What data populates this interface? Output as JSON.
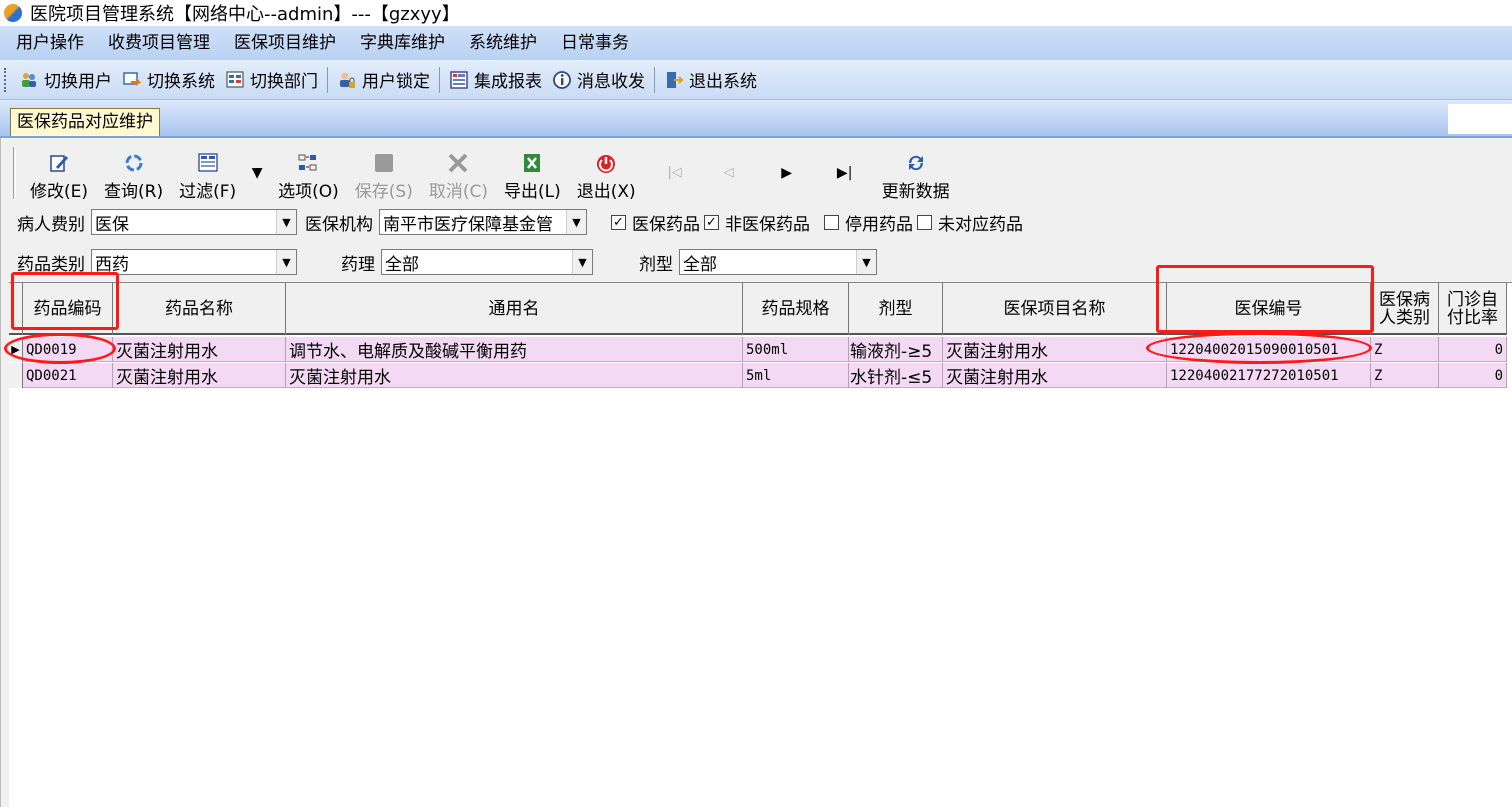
{
  "window": {
    "title": "医院项目管理系统【网络中心--admin】---【gzxyy】"
  },
  "menu": [
    "用户操作",
    "收费项目管理",
    "医保项目维护",
    "字典库维护",
    "系统维护",
    "日常事务"
  ],
  "toolbar": {
    "switch_user": "切换用户",
    "switch_system": "切换系统",
    "switch_dept": "切换部门",
    "user_lock": "用户锁定",
    "integrated_report": "集成报表",
    "message": "消息收发",
    "exit_system": "退出系统"
  },
  "tab": {
    "label": "医保药品对应维护"
  },
  "form_toolbar": {
    "modify": "修改(E)",
    "query": "查询(R)",
    "filter": "过滤(F)",
    "options": "选项(O)",
    "save": "保存(S)",
    "cancel": "取消(C)",
    "export": "导出(L)",
    "exit": "退出(X)",
    "refresh": "更新数据"
  },
  "filters": {
    "patient_type_label": "病人费别",
    "patient_type_value": "医保",
    "insurance_org_label": "医保机构",
    "insurance_org_value": "南平市医疗保障基金管",
    "chk_insured_label": "医保药品",
    "chk_noninsured_label": "非医保药品",
    "chk_disabled_label": "停用药品",
    "chk_unmatched_label": "未对应药品",
    "drug_category_label": "药品类别",
    "drug_category_value": "西药",
    "pharmacology_label": "药理",
    "pharmacology_value": "全部",
    "dosage_form_label": "剂型",
    "dosage_form_value": "全部"
  },
  "grid": {
    "columns": [
      "药品编码",
      "药品名称",
      "通用名",
      "药品规格",
      "剂型",
      "医保项目名称",
      "医保编号",
      "医保病人类别",
      "门诊自付比率"
    ],
    "rows": [
      [
        "QD0019",
        "灭菌注射用水",
        "调节水、电解质及酸碱平衡用药",
        "500ml",
        "输液剂-≥5",
        "灭菌注射用水",
        "12204002015090010501",
        "Z",
        "0"
      ],
      [
        "QD0021",
        "灭菌注射用水",
        "灭菌注射用水",
        "5ml",
        "水针剂-≤5",
        "灭菌注射用水",
        "12204002177272010501",
        "Z",
        "0"
      ]
    ]
  },
  "colors": {
    "highlight": "#ff1a1a",
    "row_background": "#f4d9f4",
    "menu_background": "#c3d7f4"
  }
}
